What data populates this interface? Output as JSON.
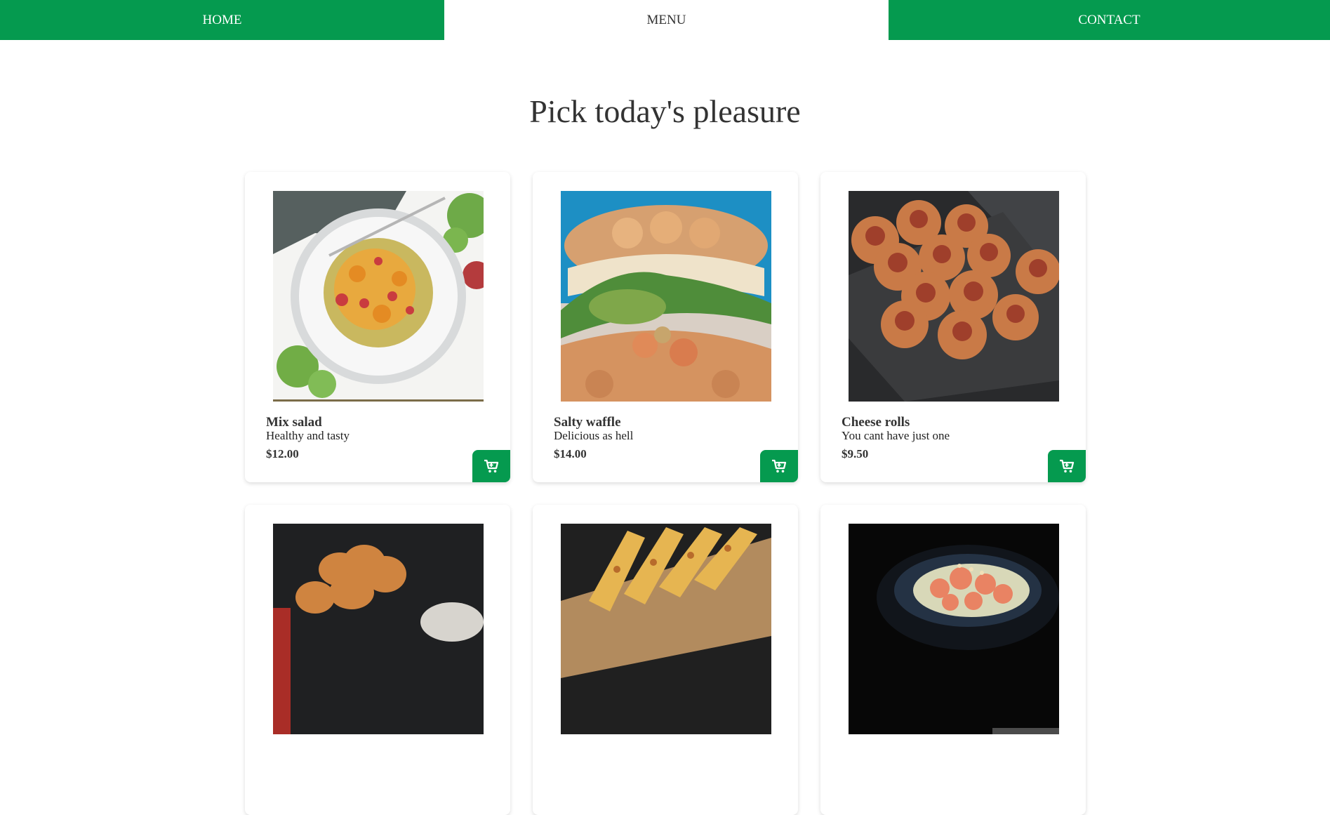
{
  "nav": {
    "home": "HOME",
    "menu": "MENU",
    "contact": "CONTACT"
  },
  "page": {
    "title": "Pick today's pleasure"
  },
  "products": [
    {
      "name": "Mix salad",
      "description": "Healthy and tasty",
      "price": "$12.00",
      "image": "mix-salad-photo"
    },
    {
      "name": "Salty waffle",
      "description": "Delicious as hell",
      "price": "$14.00",
      "image": "salty-waffle-photo"
    },
    {
      "name": "Cheese rolls",
      "description": "You cant have just one",
      "price": "$9.50",
      "image": "cheese-rolls-photo"
    },
    {
      "image": "fried-rolls-photo"
    },
    {
      "image": "cheese-breadsticks-photo"
    },
    {
      "image": "shrimp-bowl-photo"
    }
  ],
  "colors": {
    "accent": "#059a4f",
    "text": "#333333"
  },
  "icons": {
    "cart": "shopping-cart-icon"
  }
}
